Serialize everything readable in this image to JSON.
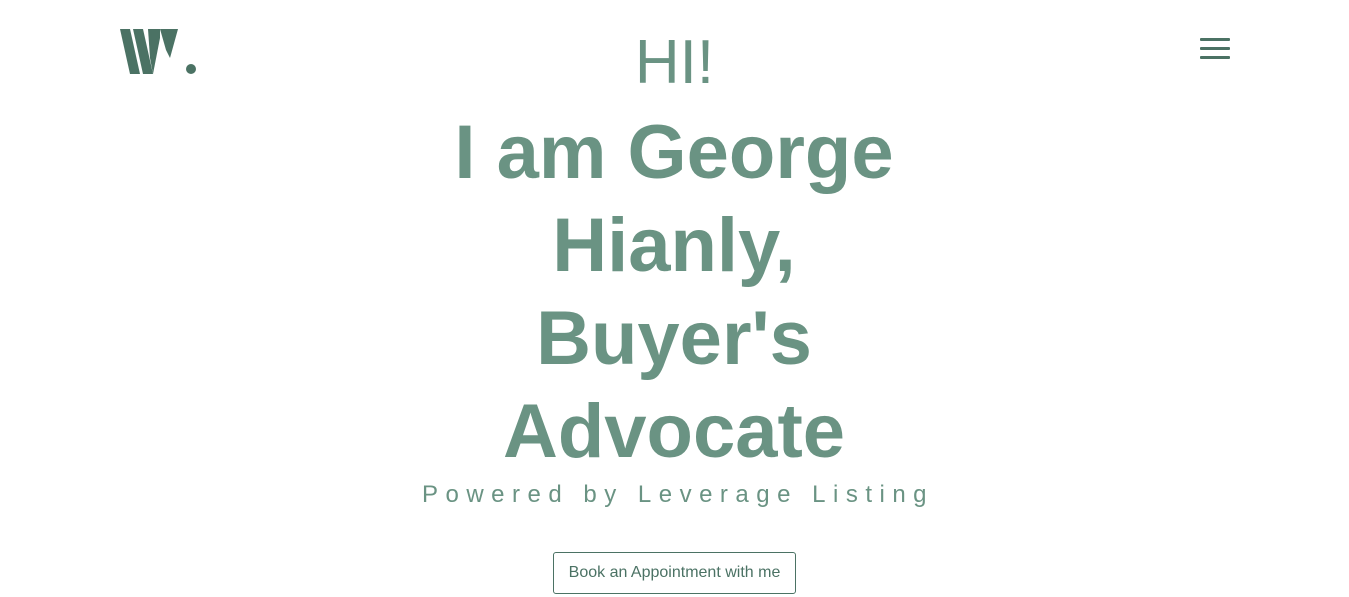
{
  "header": {
    "logo_icon": "w-dot-logo-icon",
    "menu_icon": "hamburger-menu-icon"
  },
  "hero": {
    "greeting": "HI!",
    "headline_lines": [
      "I am George",
      "Hianly,",
      "Buyer's",
      "Advocate"
    ],
    "tagline": "Powered by Leverage Listing",
    "cta_label": "Book an Appointment with me"
  },
  "colors": {
    "brand_dark": "#4b7264",
    "brand_text": "#6a9383",
    "background": "#ffffff"
  }
}
